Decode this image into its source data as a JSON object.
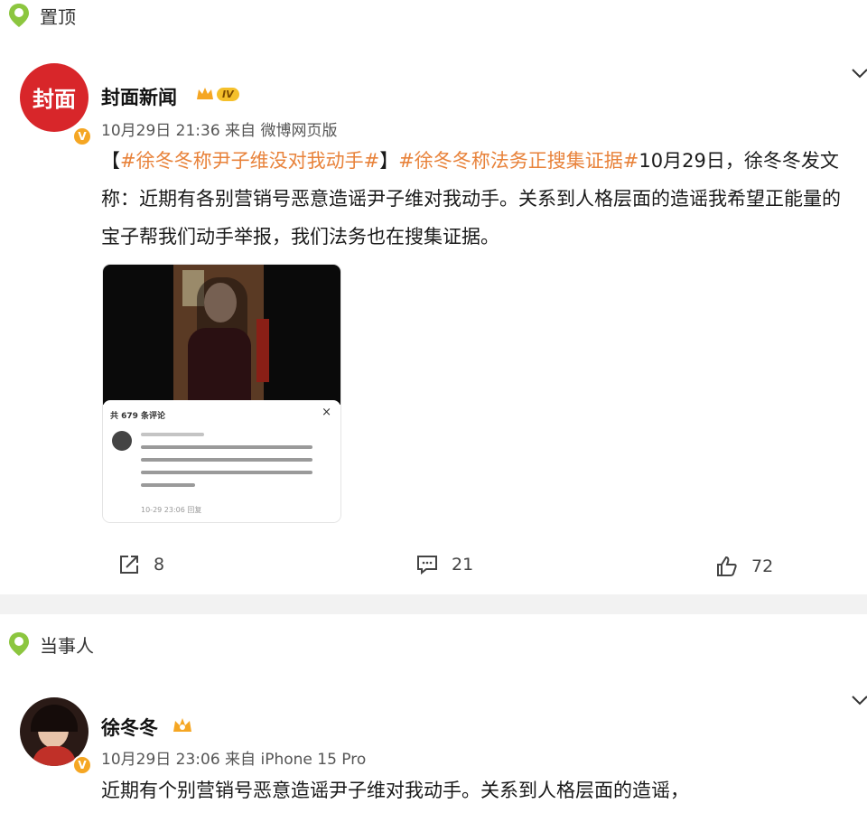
{
  "pinned": {
    "label": "置顶"
  },
  "post1": {
    "author": "封面新闻",
    "avatar_text": "封面",
    "level_badge": "IV",
    "meta": "10月29日 21:36  来自 微博网页版",
    "text_prefix": "【",
    "topic1": "#徐冬冬称尹子维没对我动手#",
    "text_mid": "】",
    "topic2": "#徐冬冬称法务正搜集证据#",
    "text_body": "10月29日，徐冬冬发文称：近期有各别营销号恶意造谣尹子维对我动手。关系到人格层面的造谣我希望正能量的宝子帮我们动手举报，我们法务也在搜集证据。",
    "embed": {
      "comment_count": "共 679 条评论",
      "close": "×",
      "footer": "10-29 23:06  回复"
    },
    "actions": {
      "share_count": "8",
      "comment_count": "21",
      "like_count": "72"
    }
  },
  "party": {
    "label": "当事人"
  },
  "post2": {
    "author": "徐冬冬",
    "meta": "10月29日 23:06  来自 iPhone 15 Pro",
    "text_body": "近期有个别营销号恶意造谣尹子维对我动手。关系到人格层面的造谣，"
  },
  "colors": {
    "topic": "#e8823a",
    "brand_red": "#d8262a",
    "badge_gold": "#f5a623",
    "location_green": "#8cc63f"
  }
}
